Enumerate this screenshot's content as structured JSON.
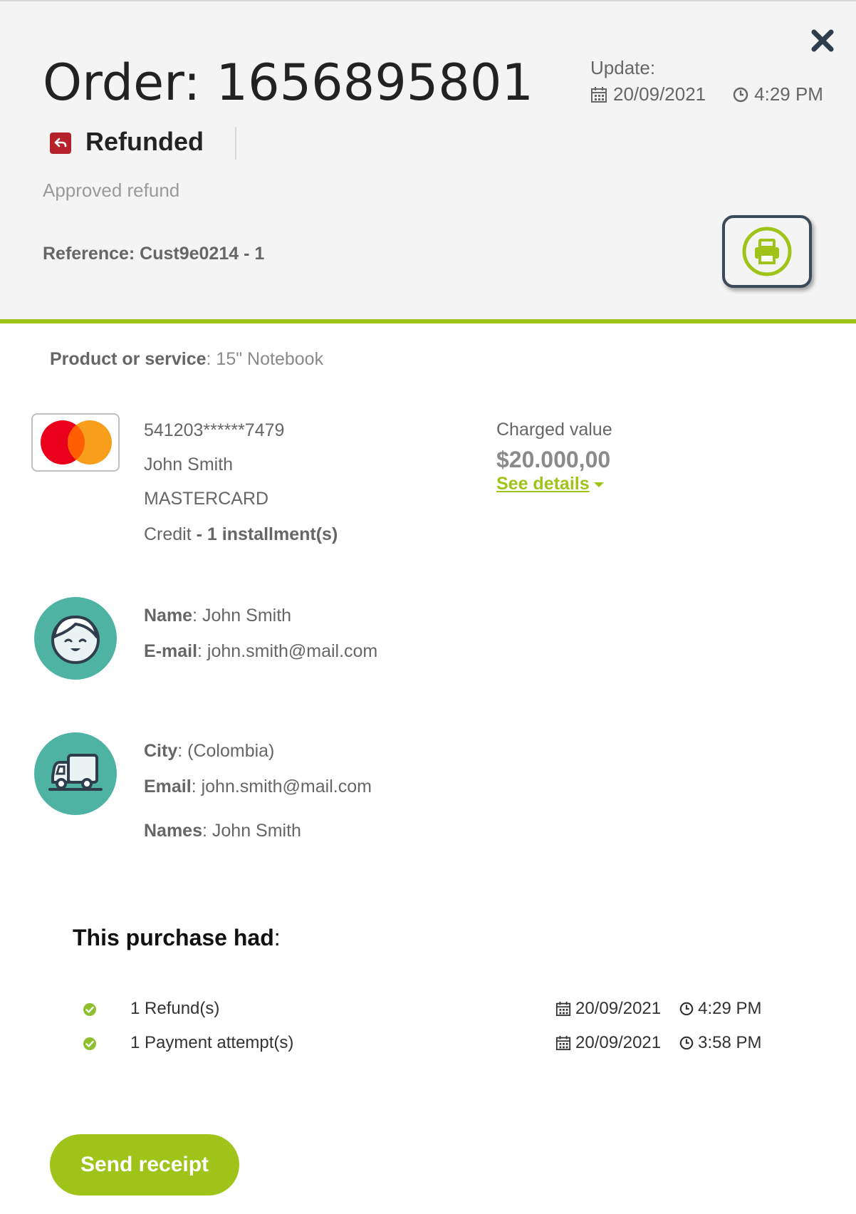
{
  "order": {
    "title": "Order: 1656895801",
    "update_label": "Update:",
    "update_date": "20/09/2021",
    "update_time": "4:29 PM",
    "status": "Refunded",
    "status_sub": "Approved refund",
    "reference": "Reference: Cust9e0214 - 1"
  },
  "product": {
    "label": "Product or service",
    "value": ": 15\" Notebook"
  },
  "card": {
    "number": "541203******7479",
    "holder": "John Smith",
    "brand": "MASTERCARD",
    "type": "Credit",
    "installments_sep": " - ",
    "installments": "1 installment(s)"
  },
  "charge": {
    "label": "Charged value",
    "value": "$20.000,00",
    "details_link": "See details"
  },
  "customer": {
    "name_label": "Name",
    "name_value": ": John Smith",
    "email_label": "E-mail",
    "email_value": ": john.smith@mail.com"
  },
  "shipping": {
    "city_label": "City",
    "city_value": ": (Colombia)",
    "email_label": "Email",
    "email_value": ": john.smith@mail.com",
    "names_label": "Names",
    "names_value": ": John Smith"
  },
  "history": {
    "title": "This purchase had",
    "title_colon": ":",
    "items": [
      {
        "label": "1 Refund(s)",
        "date": "20/09/2021",
        "time": "4:29 PM"
      },
      {
        "label": "1 Payment attempt(s)",
        "date": "20/09/2021",
        "time": "3:58 PM"
      }
    ]
  },
  "actions": {
    "send_receipt": "Send receipt"
  },
  "colors": {
    "accent": "#9ec41a",
    "refund_red": "#b5222b",
    "avatar_teal": "#4fb3a4",
    "dark_navy": "#3b4a58"
  },
  "icons": {
    "close": "close-icon",
    "calendar": "calendar-icon",
    "clock": "clock-icon",
    "refund": "refund-arrow-icon",
    "print": "printer-icon",
    "card": "mastercard-logo",
    "customer": "customer-face-icon",
    "shipping": "truck-icon",
    "check": "check-circle-icon",
    "caret": "caret-down-icon"
  }
}
